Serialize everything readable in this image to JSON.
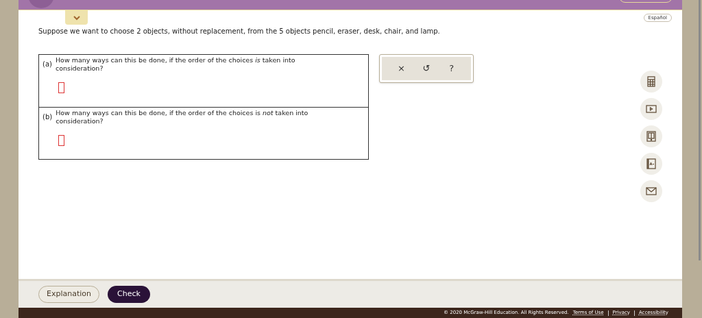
{
  "language_button": "Español",
  "problem": "Suppose we want to choose 2 objects, without replacement, from the 5 objects pencil, eraser, desk, chair, and lamp.",
  "parts": [
    {
      "label": "(a)",
      "question": "How many ways can this be done, if the order of the choices *is* taken into consideration?"
    },
    {
      "label": "(b)",
      "question": "How many ways can this be done, if the order of the choices is *not* taken into consideration?"
    }
  ],
  "toolbar": [
    "×",
    "↺",
    "?"
  ],
  "side_tools": [
    {
      "kind": "calculator"
    },
    {
      "kind": "video"
    },
    {
      "kind": "ebook"
    },
    {
      "kind": "glossary"
    },
    {
      "kind": "mail"
    }
  ],
  "buttons": [
    {
      "label": "Explanation",
      "kind": "secondary"
    },
    {
      "label": "Check",
      "kind": "primary"
    }
  ],
  "footer": {
    "copyright": "© 2020 McGraw-Hill Education. All Rights Reserved.",
    "links": [
      "Terms of Use",
      "Privacy",
      "Accessibility"
    ]
  }
}
